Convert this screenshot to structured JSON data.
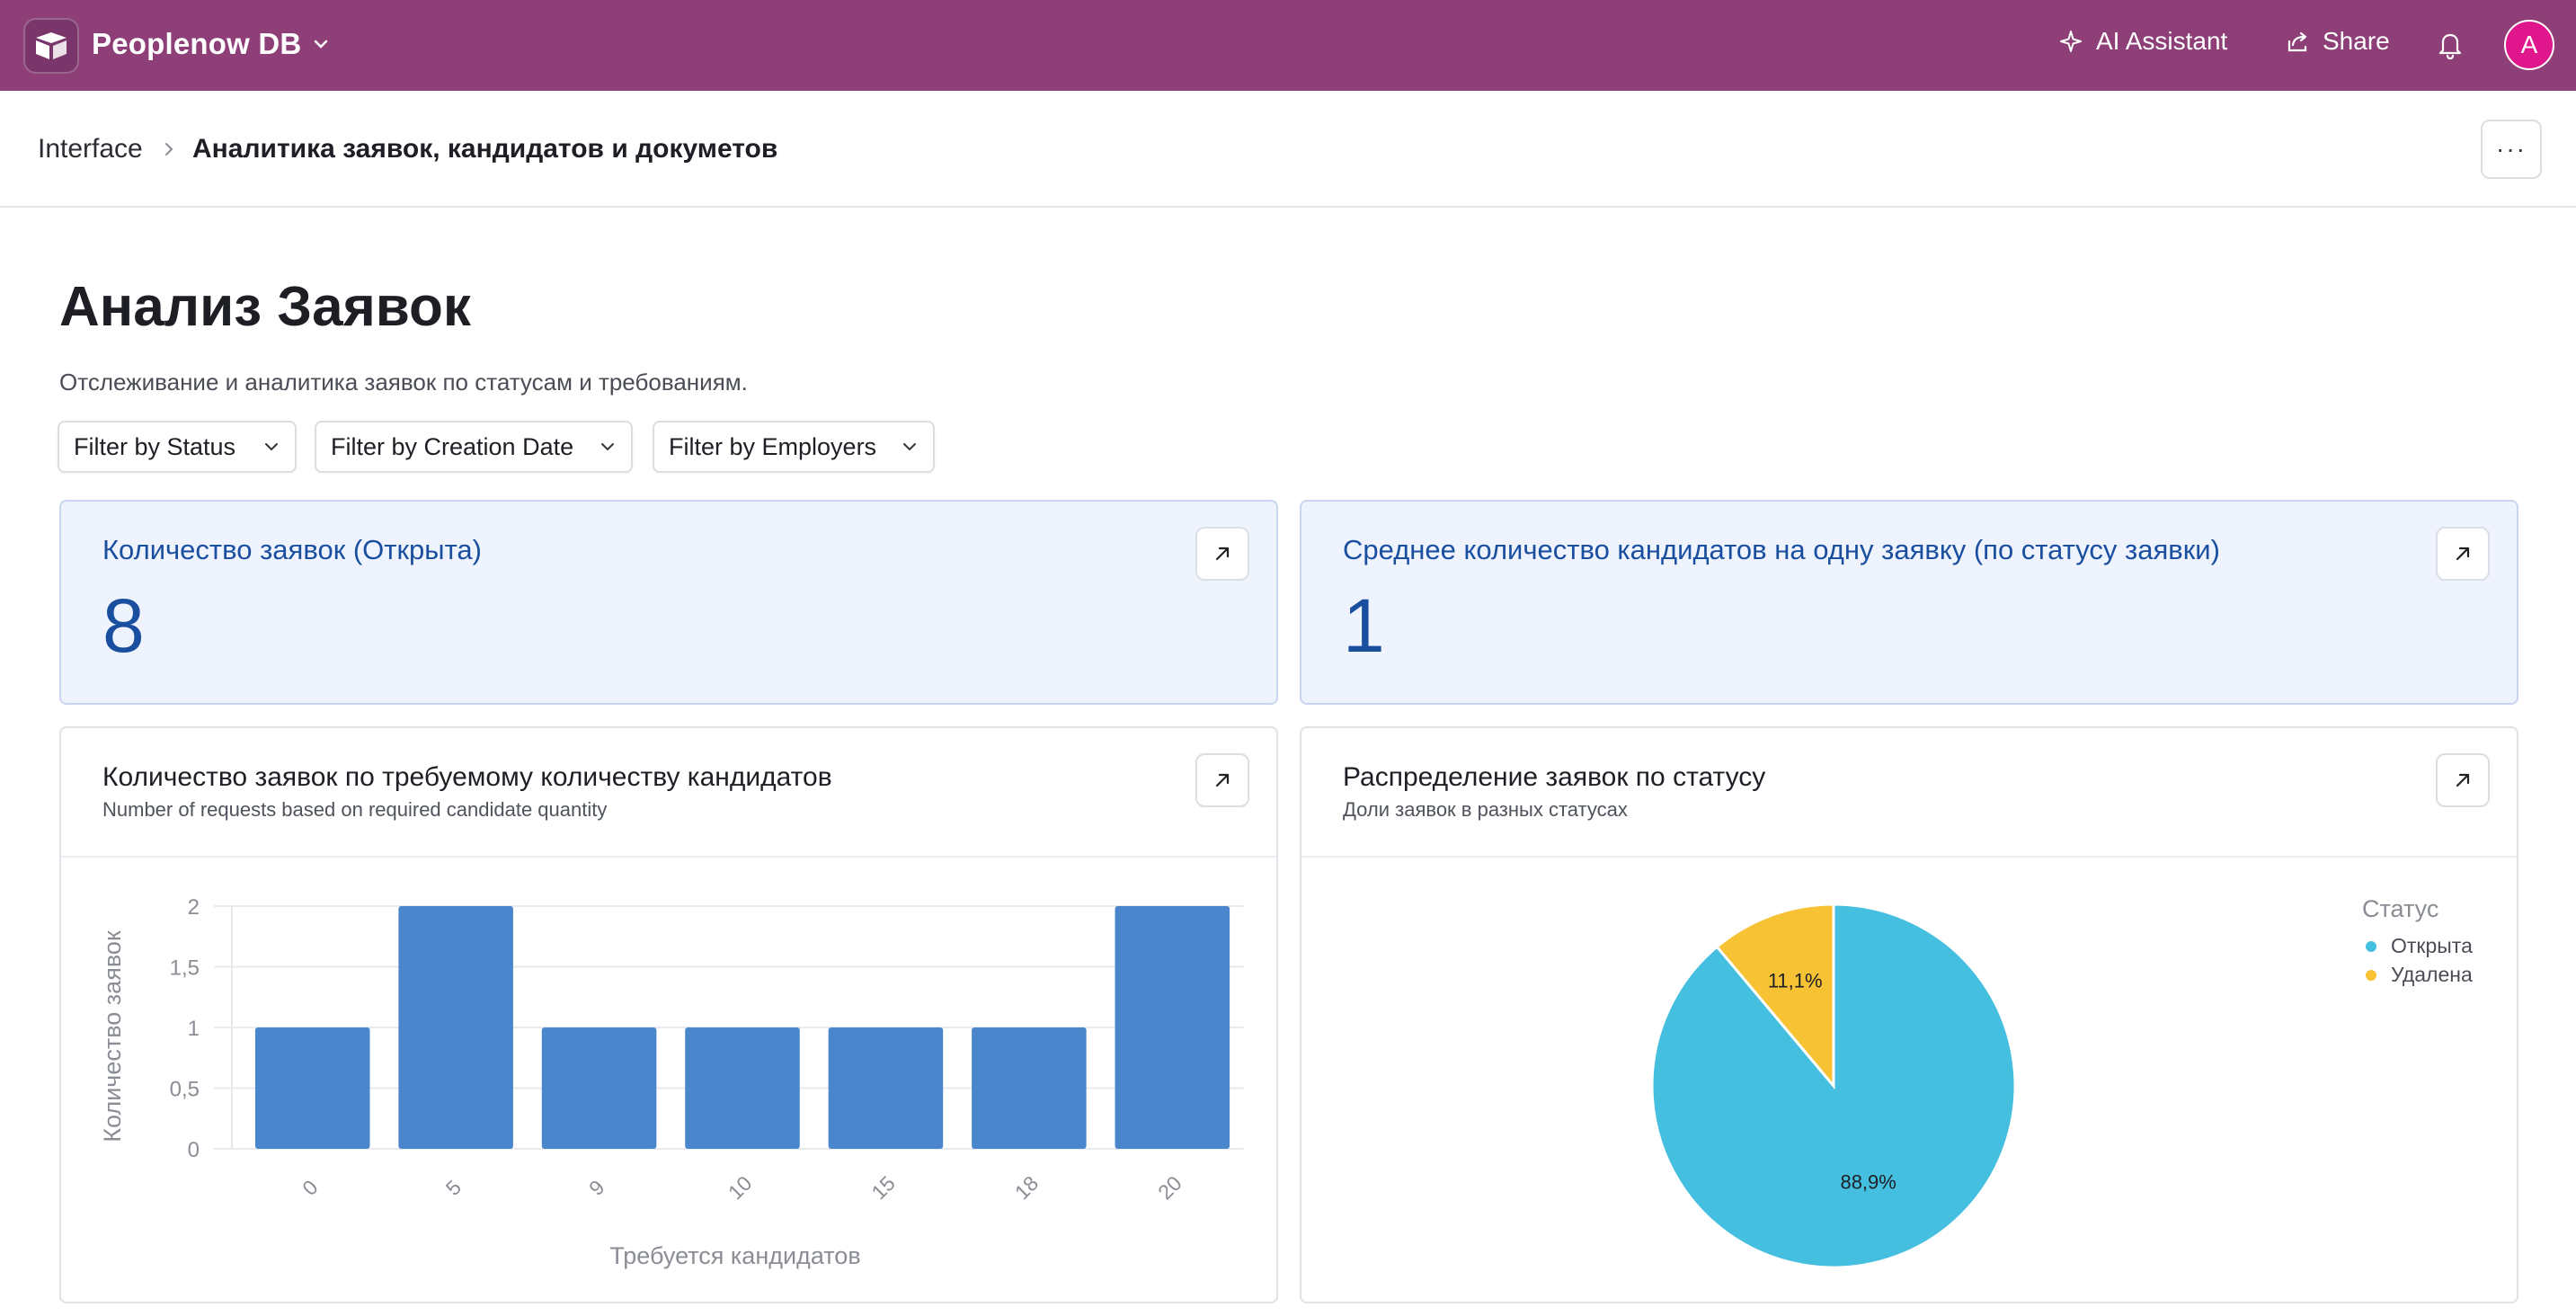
{
  "app": {
    "name": "Peoplenow DB",
    "ai_label": "AI Assistant",
    "share_label": "Share",
    "avatar_letter": "A",
    "brand_color": "#8e3f78"
  },
  "breadcrumb": {
    "root": "Interface",
    "current": "Аналитика заявок, кандидатов и докуметов",
    "more": "···"
  },
  "page": {
    "title": "Анализ Заявок",
    "subtitle": "Отслеживание и аналитика заявок по статусам и требованиям."
  },
  "filters": [
    {
      "label": "Filter by Status"
    },
    {
      "label": "Filter by Creation Date"
    },
    {
      "label": "Filter by Employers"
    }
  ],
  "kpis": [
    {
      "title": "Количество заявок (Открыта)",
      "value": "8"
    },
    {
      "title": "Среднее количество кандидатов на одну заявку (по статусу заявки)",
      "value": "1"
    }
  ],
  "charts": {
    "bar": {
      "title": "Количество заявок по требуемому количеству кандидатов",
      "subtitle": "Number of requests based on required candidate quantity"
    },
    "pie": {
      "title": "Распределение заявок по статусу",
      "subtitle": "Доли заявок в разных статусах"
    }
  },
  "chart_data": [
    {
      "type": "bar",
      "categories": [
        "0",
        "5",
        "9",
        "10",
        "15",
        "18",
        "20"
      ],
      "values": [
        1,
        2,
        1,
        1,
        1,
        1,
        2
      ],
      "xlabel": "Требуется кандидатов",
      "ylabel": "Количество заявок",
      "ylim": [
        0,
        2
      ],
      "yticks": [
        "0",
        "0,5",
        "1",
        "1,5",
        "2"
      ],
      "grid": true,
      "color": "#4a86cc"
    },
    {
      "type": "pie",
      "legend_title": "Статус",
      "legend_position": "top-right",
      "slices": [
        {
          "label": "Открыта",
          "value": 88.9,
          "display": "88,9%",
          "color": "#45bfe0"
        },
        {
          "label": "Удалена",
          "value": 11.1,
          "display": "11,1%",
          "color": "#f8c235"
        }
      ]
    }
  ]
}
